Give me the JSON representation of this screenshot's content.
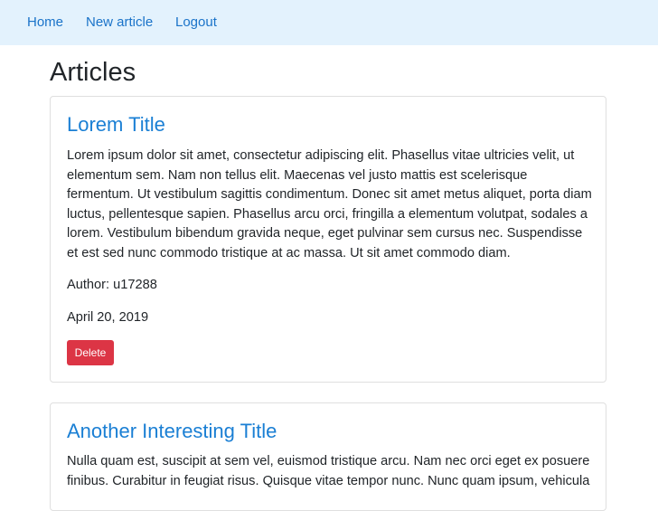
{
  "nav": {
    "home": "Home",
    "new_article": "New article",
    "logout": "Logout"
  },
  "page": {
    "heading": "Articles"
  },
  "articles": [
    {
      "title": "Lorem Title",
      "body": "Lorem ipsum dolor sit amet, consectetur adipiscing elit. Phasellus vitae ultricies velit, ut elementum sem. Nam non tellus elit. Maecenas vel justo mattis est scelerisque fermentum. Ut vestibulum sagittis condimentum. Donec sit amet metus aliquet, porta diam luctus, pellentesque sapien. Phasellus arcu orci, fringilla a elementum volutpat, sodales a lorem. Vestibulum bibendum gravida neque, eget pulvinar sem cursus nec. Suspendisse et est sed nunc commodo tristique at ac massa. Ut sit amet commodo diam.",
      "author": "Author: u17288",
      "date": "April 20, 2019",
      "delete_label": "Delete"
    },
    {
      "title": "Another Interesting Title",
      "body": "Nulla quam est, suscipit at sem vel, euismod tristique arcu. Nam nec orci eget ex posuere finibus. Curabitur in feugiat risus. Quisque vitae tempor nunc. Nunc quam ipsum, vehicula"
    }
  ],
  "colors": {
    "navbar_bg": "#e3f2fd",
    "link": "#1a73c9",
    "title": "#1a7fd4",
    "danger": "#dc3545"
  }
}
